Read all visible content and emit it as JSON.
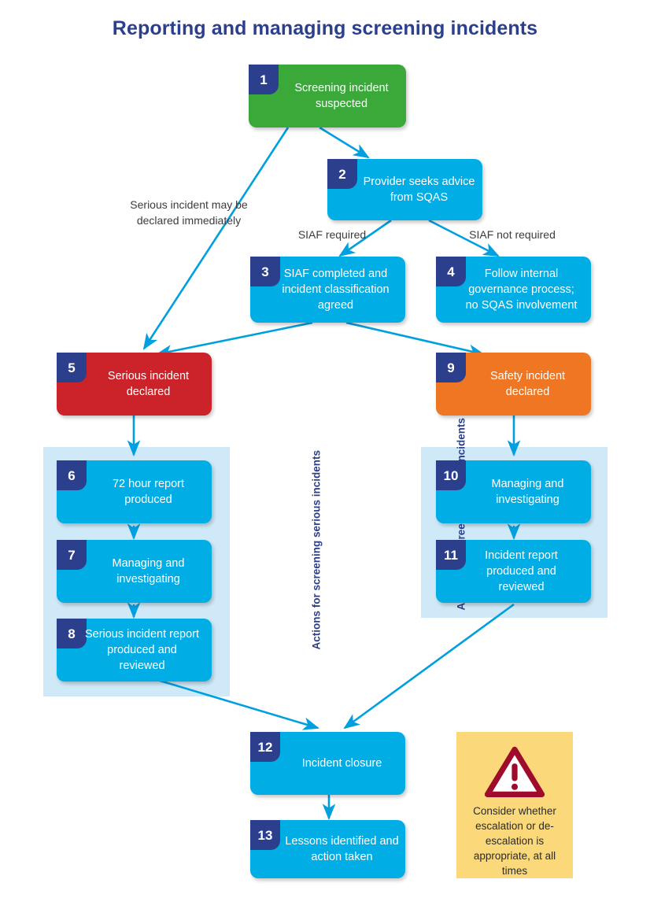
{
  "title": "Reporting and managing screening incidents",
  "colors": {
    "title": "#2b3f8c",
    "badge": "#2b3f8c",
    "green": "#3aa93a",
    "cyan": "#00ade5",
    "red": "#cc2229",
    "orange": "#ef7622",
    "panel": "#cfe9f8",
    "arrow": "#00a0e0",
    "warning_bg": "#fbd97a",
    "warning_stroke": "#9e0b2b"
  },
  "nodes": [
    {
      "id": 1,
      "number": "1",
      "label": "Screening incident suspected",
      "color": "green"
    },
    {
      "id": 2,
      "number": "2",
      "label": "Provider seeks advice from SQAS",
      "color": "cyan"
    },
    {
      "id": 3,
      "number": "3",
      "label": "SIAF completed and incident classification agreed",
      "color": "cyan"
    },
    {
      "id": 4,
      "number": "4",
      "label": "Follow internal governance process; no SQAS involvement",
      "color": "cyan"
    },
    {
      "id": 5,
      "number": "5",
      "label": "Serious incident declared",
      "color": "red"
    },
    {
      "id": 6,
      "number": "6",
      "label": "72 hour report produced",
      "color": "cyan"
    },
    {
      "id": 7,
      "number": "7",
      "label": "Managing and investigating",
      "color": "cyan"
    },
    {
      "id": 8,
      "number": "8",
      "label": "Serious incident report produced and reviewed",
      "color": "cyan"
    },
    {
      "id": 9,
      "number": "9",
      "label": "Safety incident declared",
      "color": "orange"
    },
    {
      "id": 10,
      "number": "10",
      "label": "Managing and investigating",
      "color": "cyan"
    },
    {
      "id": 11,
      "number": "11",
      "label": "Incident report produced and reviewed",
      "color": "cyan"
    },
    {
      "id": 12,
      "number": "12",
      "label": "Incident closure",
      "color": "cyan"
    },
    {
      "id": 13,
      "number": "13",
      "label": "Lessons identified and action taken",
      "color": "cyan"
    }
  ],
  "edge_labels": {
    "siaf_required": "SIAF required",
    "siaf_not_required": "SIAF not required"
  },
  "annotations": {
    "serious_immediate": "Serious incident may be declared immediately"
  },
  "groups": {
    "serious": "Actions for screening serious incidents",
    "safety": "Actions for screening safety incidents"
  },
  "warning": {
    "icon": "warning-triangle-icon",
    "text": "Consider whether escalation or de-escalation is appropriate, at all times"
  }
}
